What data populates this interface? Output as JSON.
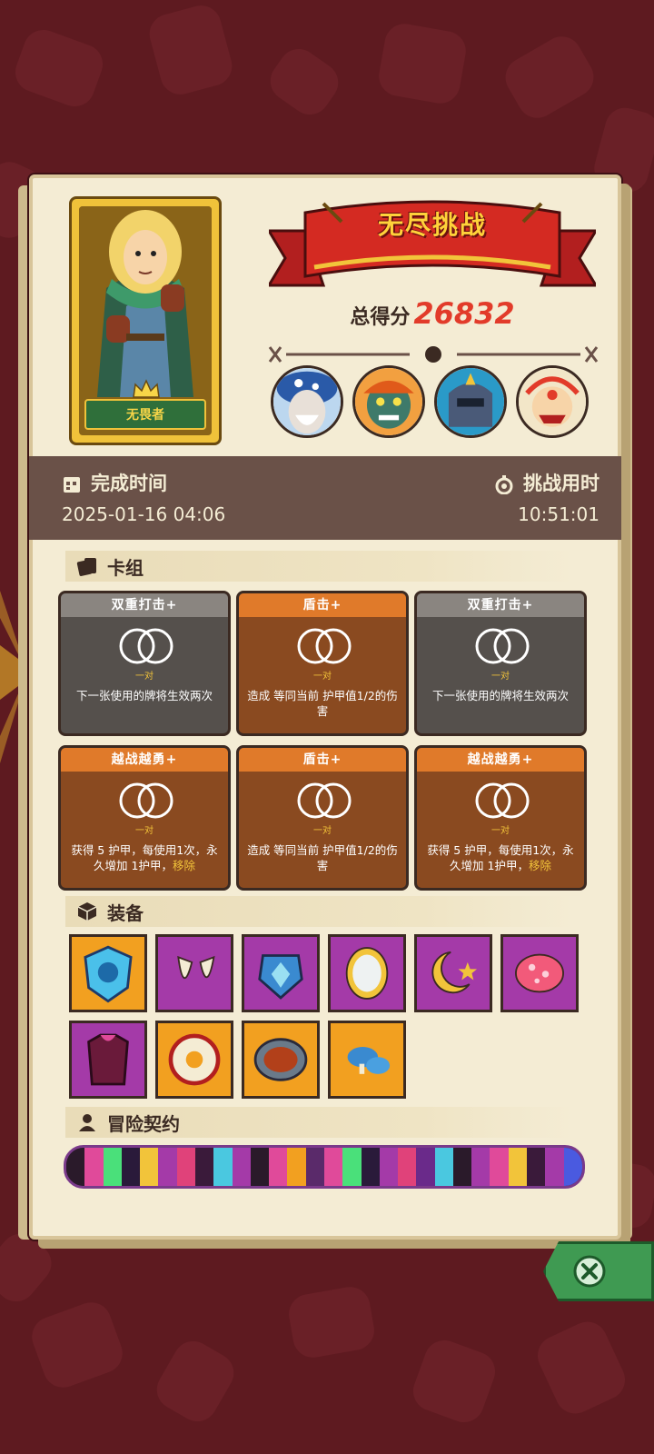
{
  "mode_title": "无尽挑战",
  "hero": {
    "name": "无畏者"
  },
  "score": {
    "label": "总得分",
    "value": "26832"
  },
  "time": {
    "complete_label": "完成时间",
    "complete_value": "2025-01-16 04:06",
    "duration_label": "挑战用时",
    "duration_value": "10:51:01"
  },
  "sections": {
    "deck": "卡组",
    "equipment": "装备",
    "contract": "冒险契约"
  },
  "cards": [
    {
      "title": "双重打击+",
      "color": "gray",
      "tag": "一对",
      "desc": "下一张使用的牌将生效两次"
    },
    {
      "title": "盾击+",
      "color": "orange",
      "tag": "一对",
      "desc": "造成 等同当前 护甲值1/2的伤害"
    },
    {
      "title": "双重打击+",
      "color": "gray",
      "tag": "一对",
      "desc": "下一张使用的牌将生效两次"
    },
    {
      "title": "越战越勇+",
      "color": "orange",
      "tag": "一对",
      "desc": "获得 5 护甲，每使用1次，永久增加 1护甲，",
      "desc_hl": "移除"
    },
    {
      "title": "盾击+",
      "color": "orange",
      "tag": "一对",
      "desc": "造成 等同当前 护甲值1/2的伤害"
    },
    {
      "title": "越战越勇+",
      "color": "orange",
      "tag": "一对",
      "desc": "获得 5 护甲，每使用1次，永久增加 1护甲，",
      "desc_hl": "移除"
    }
  ],
  "equipment": [
    {
      "icon": "blue-shield-icon",
      "bg": "orange"
    },
    {
      "icon": "fangs-icon",
      "bg": "purple"
    },
    {
      "icon": "blue-armor-icon",
      "bg": "purple"
    },
    {
      "icon": "mirror-icon",
      "bg": "purple"
    },
    {
      "icon": "moon-star-icon",
      "bg": "purple"
    },
    {
      "icon": "spotted-seed-icon",
      "bg": "purple"
    },
    {
      "icon": "tunic-icon",
      "bg": "purple"
    },
    {
      "icon": "round-shield-icon",
      "bg": "orange"
    },
    {
      "icon": "pan-icon",
      "bg": "orange"
    },
    {
      "icon": "blue-mushroom-icon",
      "bg": "orange"
    }
  ],
  "bosses": [
    "mushroom-sage-icon",
    "orange-ogre-icon",
    "armored-knight-icon",
    "demon-mask-icon"
  ]
}
